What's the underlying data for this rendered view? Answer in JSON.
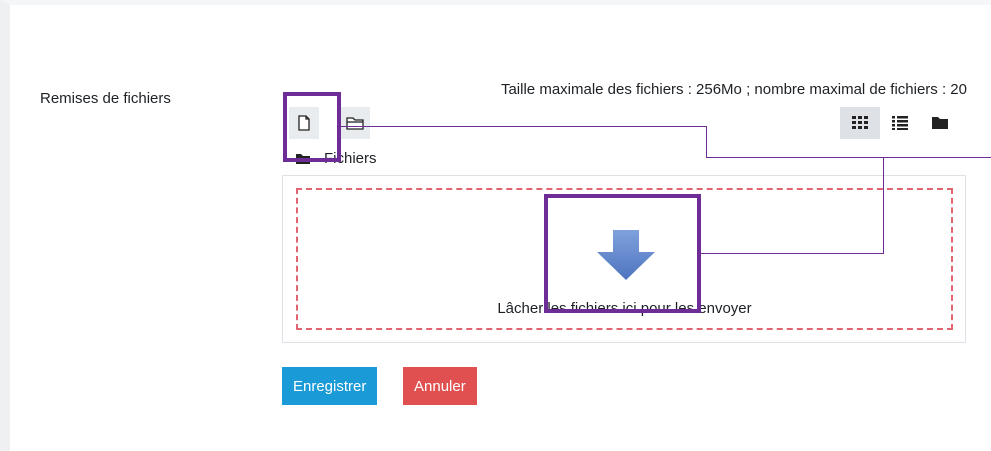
{
  "form": {
    "field_label": "Remises de fichiers",
    "max_info": "Taille maximale des fichiers : 256Mo ; nombre maximal de fichiers : 20",
    "path_label": "Fichiers",
    "drop_text": "Lâcher les fichiers ici pour les envoyer"
  },
  "toolbar": {
    "add_file_icon": "file-icon",
    "create_folder_icon": "folder-icon",
    "views": [
      "grid-view-icon",
      "list-view-icon",
      "tree-view-icon"
    ],
    "active_view": "grid-view-icon"
  },
  "buttons": {
    "save_label": "Enregistrer",
    "cancel_label": "Annuler"
  },
  "colors": {
    "save": "#1a9ad6",
    "cancel": "#e05050",
    "dropzone_border": "#e06570",
    "annotation": "#6e2c96",
    "arrow": "#5b82c9"
  }
}
